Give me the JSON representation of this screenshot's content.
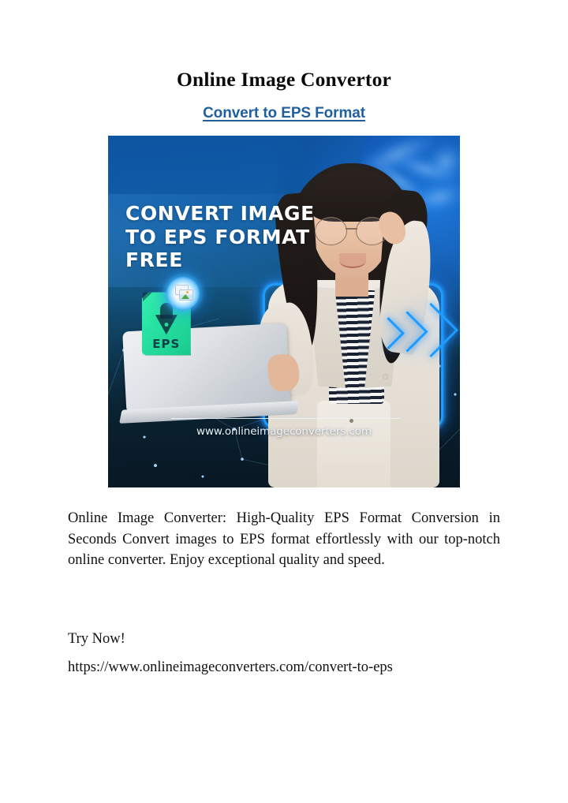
{
  "document": {
    "title": "Online Image Convertor",
    "subtitle_link": "Convert to EPS Format",
    "subtitle_link_color": "#21609f",
    "paragraph": "Online Image Converter: High-Quality EPS Format Conversion in Seconds Convert images to EPS format effortlessly with our top-notch online converter. Enjoy exceptional quality and speed.",
    "cta": "Try Now!",
    "url": "https://www.onlineimageconverters.com/convert-to-eps"
  },
  "banner": {
    "headline_lines": [
      "CONVERT IMAGE",
      "TO EPS FORMAT",
      "FREE"
    ],
    "watermark_url": "www.onlineimageconverters.com",
    "eps_badge_label": "EPS",
    "icons": {
      "file_icon": "eps-file-icon",
      "pen_nib": "pen-nib-icon",
      "photo_badge": "photo-stack-icon",
      "chevrons": "chevron-right-icon"
    },
    "colors": {
      "eps_green": "#24dd9e",
      "neon_blue": "#1e9bff",
      "bg_top_blue": "#0d5aa8",
      "bg_bottom_navy": "#081722"
    }
  }
}
